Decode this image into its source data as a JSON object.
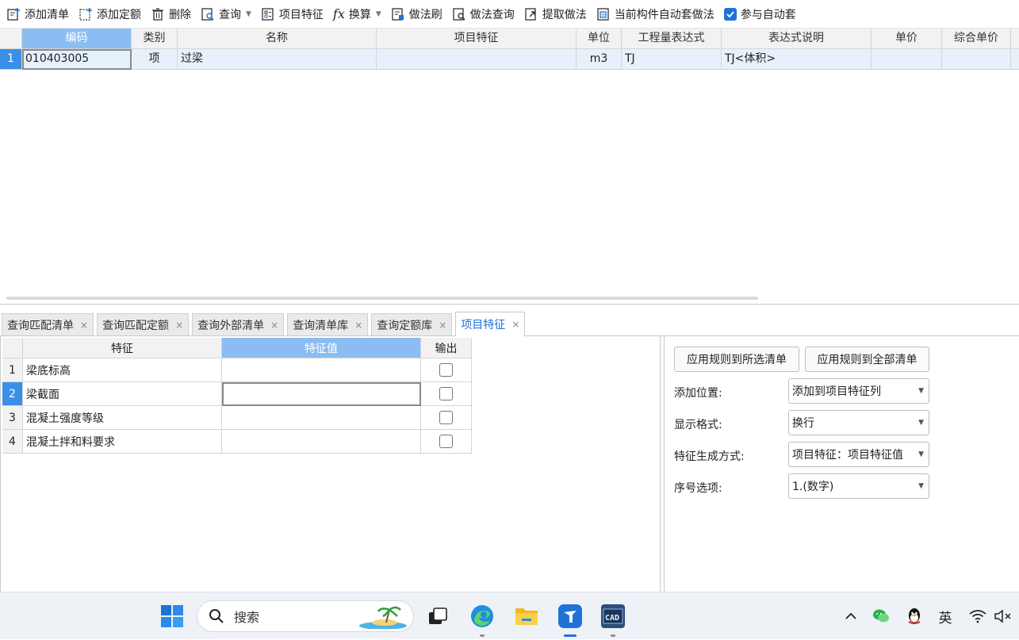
{
  "toolbar": {
    "add_list": "添加清单",
    "add_quota": "添加定额",
    "delete": "删除",
    "query": "查询",
    "project_feature": "项目特征",
    "convert": "换算",
    "method_brush": "做法刷",
    "method_query": "做法查询",
    "extract_method": "提取做法",
    "auto_apply": "当前构件自动套做法",
    "participate_auto": "参与自动套"
  },
  "upper_grid": {
    "columns": [
      "编码",
      "类别",
      "名称",
      "项目特征",
      "单位",
      "工程量表达式",
      "表达式说明",
      "单价",
      "综合单价"
    ],
    "rows": [
      {
        "num": "1",
        "code": "010403005",
        "type": "项",
        "name": "过梁",
        "feature": "",
        "unit": "m3",
        "expr": "TJ",
        "expr_desc": "TJ<体积>",
        "price": "",
        "total_price": ""
      }
    ]
  },
  "tabs": [
    {
      "label": "查询匹配清单",
      "close": "×"
    },
    {
      "label": "查询匹配定额",
      "close": "×"
    },
    {
      "label": "查询外部清单",
      "close": "×"
    },
    {
      "label": "查询清单库",
      "close": "×"
    },
    {
      "label": "查询定额库",
      "close": "×"
    },
    {
      "label": "项目特征",
      "close": "×"
    }
  ],
  "feature_grid": {
    "columns": [
      "特征",
      "特征值",
      "输出"
    ],
    "rows": [
      {
        "num": "1",
        "feature": "梁底标高",
        "value": ""
      },
      {
        "num": "2",
        "feature": "梁截面",
        "value": ""
      },
      {
        "num": "3",
        "feature": "混凝土强度等级",
        "value": ""
      },
      {
        "num": "4",
        "feature": "混凝土拌和料要求",
        "value": ""
      }
    ]
  },
  "settings": {
    "apply_selected": "应用规则到所选清单",
    "apply_all": "应用规则到全部清单",
    "add_position_label": "添加位置:",
    "add_position_value": "添加到项目特征列",
    "display_format_label": "显示格式:",
    "display_format_value": "换行",
    "generation_label": "特征生成方式:",
    "generation_value": "项目特征：项目特征值",
    "serial_label": "序号选项:",
    "serial_value": "1.(数字)"
  },
  "taskbar": {
    "search_text": "搜索",
    "ime": "英"
  },
  "colors": {
    "accent": "#1f72d9",
    "selected_header": "#8bbdf2",
    "selected_row": "#e6f1fc"
  }
}
